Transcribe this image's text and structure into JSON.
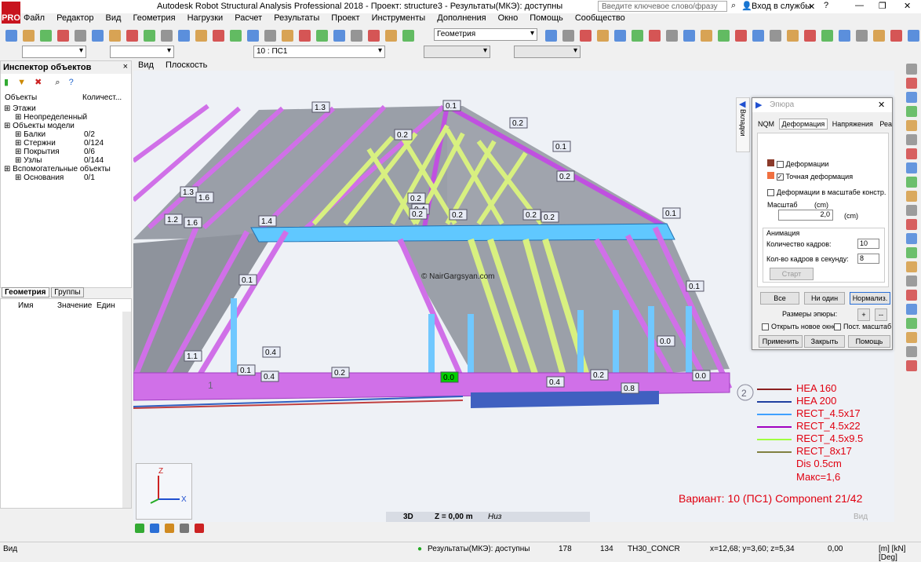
{
  "app": {
    "title": "Autodesk Robot Structural Analysis Professional 2018 - Проект: structure3 - Результаты(МКЭ): доступны",
    "logo_text": "PRO",
    "search_placeholder": "Введите ключевое слово/фразу",
    "login_label": "Вход в службы",
    "window_controls": [
      "—",
      "❐",
      "✕"
    ]
  },
  "menu": [
    "Файл",
    "Редактор",
    "Вид",
    "Геометрия",
    "Нагрузки",
    "Расчет",
    "Результаты",
    "Проект",
    "Инструменты",
    "Дополнения",
    "Окно",
    "Помощь",
    "Сообщество"
  ],
  "toolbar": {
    "layout_combo": "Геометрия",
    "case_combo": "10 : ПС1",
    "icon_colors": [
      "#2a6fd6",
      "#d08a20",
      "#3a3",
      "#c22",
      "#777",
      "#2a6fd6",
      "#d08a20",
      "#c22",
      "#3a3",
      "#777",
      "#2a6fd6",
      "#d08a20",
      "#c22",
      "#3a3",
      "#2a6fd6",
      "#777",
      "#d08a20",
      "#c22",
      "#3a3",
      "#2a6fd6",
      "#777",
      "#c22",
      "#d08a20",
      "#3a3",
      "#2a6fd6",
      "#777",
      "#c22",
      "#d08a20",
      "#2a6fd6",
      "#3a3",
      "#c22",
      "#777",
      "#2a6fd6",
      "#d08a20",
      "#3a3",
      "#c22",
      "#2a6fd6",
      "#777",
      "#d08a20",
      "#c22",
      "#3a3",
      "#2a6fd6",
      "#777",
      "#d08a20",
      "#c22",
      "#2a6fd6"
    ]
  },
  "inspector": {
    "title": "Инспектор объектов",
    "close": "×",
    "col_objects": "Объекты",
    "col_count": "Количест...",
    "tree": [
      {
        "label": "Этажи",
        "count": "",
        "level": 0
      },
      {
        "label": "Неопределенный",
        "count": "",
        "level": 1
      },
      {
        "label": "Объекты модели",
        "count": "",
        "level": 0
      },
      {
        "label": "Балки",
        "count": "0/2",
        "level": 1
      },
      {
        "label": "Стержни",
        "count": "0/124",
        "level": 1
      },
      {
        "label": "Покрытия",
        "count": "0/6",
        "level": 1
      },
      {
        "label": "Узлы",
        "count": "0/144",
        "level": 1
      },
      {
        "label": "Вспомогательные объекты",
        "count": "",
        "level": 0
      },
      {
        "label": "Основания",
        "count": "0/1",
        "level": 1
      }
    ],
    "tabs": [
      "Геометрия",
      "Группы"
    ]
  },
  "props": {
    "col_name": "Имя",
    "col_value": "Значение",
    "col_unit": "Един"
  },
  "view": {
    "tabs": [
      "Вид",
      "Плоскость"
    ],
    "mode": "3D",
    "z_label": "Z = 0,00 m",
    "z_level": "Низ",
    "watermark": "© NairGargsyan.com",
    "ghost_label": "Вид",
    "axis_x": "X",
    "axis_z": "Z",
    "node1": "1",
    "node2": "2",
    "value_labels": [
      "1.3",
      "0.1",
      "0.2",
      "0.2",
      "0.1",
      "0.2",
      "1.3",
      "1.6",
      "1.2",
      "1.6",
      "1.4",
      "0.2",
      "0.4",
      "0.2",
      "0.2",
      "0.2",
      "0.2",
      "0.1",
      "0.1",
      "0.1",
      "1.1",
      "0.4",
      "0.1",
      "0.4",
      "0.2",
      "0.0",
      "0.4",
      "0.2",
      "0.8",
      "0.0",
      "0.0"
    ],
    "variant": "Вариант: 10 (ПС1) Component 21/42"
  },
  "legend": {
    "items": [
      {
        "label": "HEA 160",
        "color": "#8b2020"
      },
      {
        "label": "HEA 200",
        "color": "#2040a0"
      },
      {
        "label": "RECT_4.5x17",
        "color": "#40a0ff"
      },
      {
        "label": "RECT_4.5x22",
        "color": "#a000c0"
      },
      {
        "label": "RECT_4.5x9.5",
        "color": "#a0ff40"
      },
      {
        "label": "RECT_8x17",
        "color": "#808040"
      }
    ],
    "dis": "Dis  0.5cm",
    "max": "Макс=1,6"
  },
  "dialog": {
    "title": "Эпюра",
    "side_tab": "Вкладки",
    "tabs": [
      "NQM",
      "Деформация",
      "Напряжения",
      "Реа"
    ],
    "deform": "Деформации",
    "exact_deform": "Точная  деформация",
    "scaled_deform": "Деформации в масштабе констр.",
    "scale_label": "Масштаб",
    "scale_unit_1": "(cm)",
    "scale_value": "2,0",
    "scale_unit_2": "(cm)",
    "animation": "Анимация",
    "frames_label": "Количество кадров:",
    "frames_value": "10",
    "fps_label": "Кол-во кадров в секунду:",
    "fps_value": "8",
    "start": "Старт",
    "all": "Все",
    "none": "Ни один",
    "normalize": "Нормализ.",
    "sizes": "Размеры эпюры:",
    "plus": "+",
    "minus": "--",
    "open_new": "Открыть новое окно",
    "const_scale": "Пост. масштаб",
    "apply": "Применить",
    "close": "Закрыть",
    "help": "Помощь"
  },
  "status": {
    "view": "Вид",
    "results": "Результаты(МКЭ): доступны",
    "n1": "178",
    "n2": "134",
    "section": "TH30_CONCR",
    "coords": "x=12,68; y=3,60; z=5,34",
    "angle": "0,00",
    "units": "[m] [kN] [Deg]"
  }
}
